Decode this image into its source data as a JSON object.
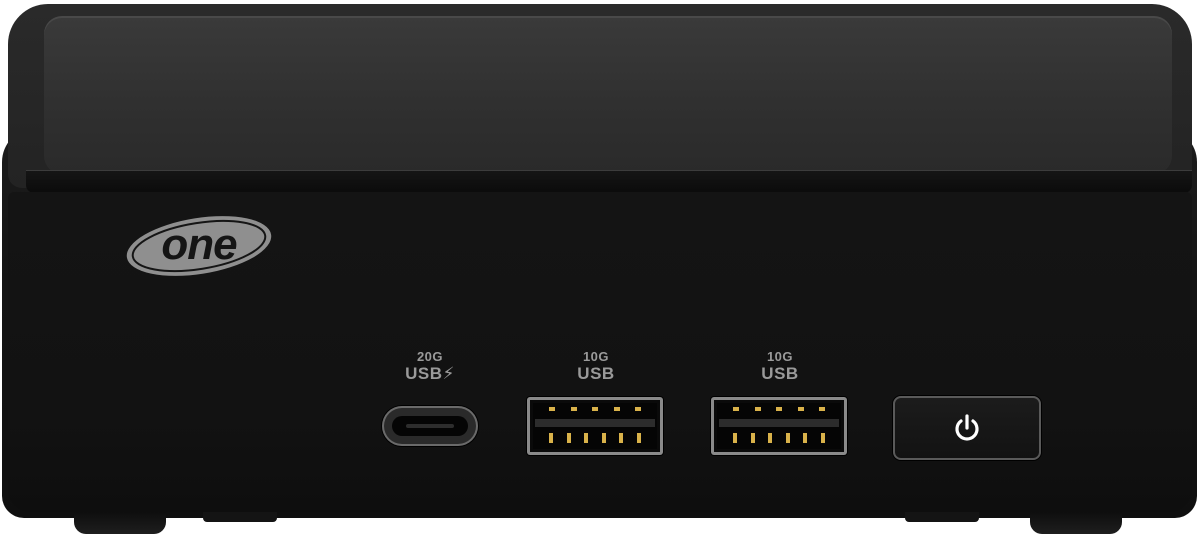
{
  "device": {
    "brand_logo": "one",
    "ports": [
      {
        "line1": "20G",
        "line2": "USB⚡",
        "connector": "usb-c"
      },
      {
        "line1": "10G",
        "line2": "USB",
        "connector": "usb-a"
      },
      {
        "line1": "10G",
        "line2": "USB",
        "connector": "usb-a"
      }
    ],
    "power_icon": "power-icon"
  },
  "colors": {
    "chassis": "#131313",
    "lid": "#333333",
    "label_text": "#9a9a9a",
    "pin_gold": "#d9b24a",
    "power_led": "#ffffff"
  }
}
